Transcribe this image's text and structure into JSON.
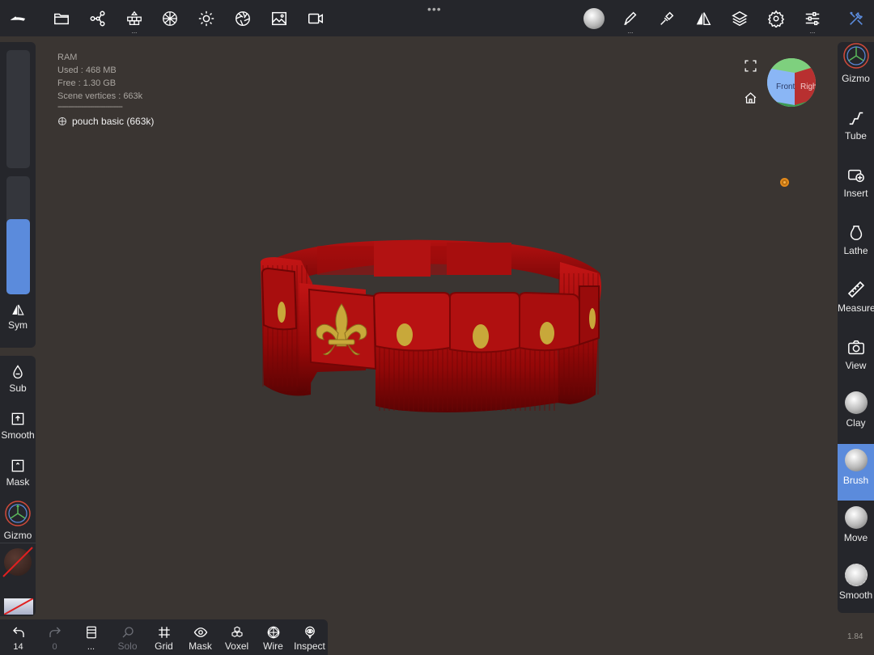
{
  "top_toolbar": {
    "icons": [
      "nomad-logo-icon",
      "folder-icon",
      "scene-graph-icon",
      "primitives-icon",
      "material-sphere-icon",
      "lighting-icon",
      "postprocess-icon",
      "background-image-icon",
      "video-icon",
      "matcap-icon",
      "paint-icon",
      "stroke-icon",
      "symmetry-icon",
      "layers-icon",
      "settings-icon",
      "topology-icon",
      "tools-icon"
    ]
  },
  "info": {
    "ram_label": "RAM",
    "used": "Used : 468 MB",
    "free": "Free : 1.30 GB",
    "scene_vertices": "Scene vertices : 663k",
    "separator": "------------------------------",
    "mesh_name": "pouch basic (663k)"
  },
  "left_panel": {
    "sym_label": "Sym",
    "radius_slider_value": 0,
    "intensity_slider_value": 0.64,
    "tools": [
      {
        "label": "Sub",
        "icon": "drop-icon"
      },
      {
        "label": "Smooth",
        "icon": "smooth-toggle-icon"
      },
      {
        "label": "Mask",
        "icon": "mask-toggle-icon"
      },
      {
        "label": "Gizmo",
        "icon": "gizmo-icon"
      }
    ]
  },
  "right_panel": {
    "tools": [
      {
        "label": "Gizmo",
        "icon": "gizmo-icon",
        "active": false
      },
      {
        "label": "Tube",
        "icon": "tube-icon",
        "active": false
      },
      {
        "label": "Insert",
        "icon": "insert-icon",
        "active": false
      },
      {
        "label": "Lathe",
        "icon": "lathe-icon",
        "active": false
      },
      {
        "label": "Measure",
        "icon": "ruler-icon",
        "active": false
      },
      {
        "label": "View",
        "icon": "camera-icon",
        "active": false
      },
      {
        "label": "Clay",
        "icon": "clay-sphere-icon",
        "active": false
      },
      {
        "label": "Brush",
        "icon": "brush-sphere-icon",
        "active": true
      },
      {
        "label": "Move",
        "icon": "move-sphere-icon",
        "active": false
      },
      {
        "label": "Smooth",
        "icon": "smooth-sphere-icon",
        "active": false
      }
    ]
  },
  "viewcube": {
    "front": "Front",
    "right": "Right"
  },
  "bottom_bar": {
    "undo_count": "14",
    "redo_count": "0",
    "more": "...",
    "solo": "Solo",
    "grid": "Grid",
    "mask": "Mask",
    "voxel": "Voxel",
    "wire": "Wire",
    "inspect": "Inspect"
  },
  "version": "1.84",
  "colors": {
    "accent": "#5b8bdc",
    "viewport": "#3a3532",
    "panel": "#25262b",
    "model_red": "#9e0a0a",
    "gold": "#c8a83a"
  }
}
